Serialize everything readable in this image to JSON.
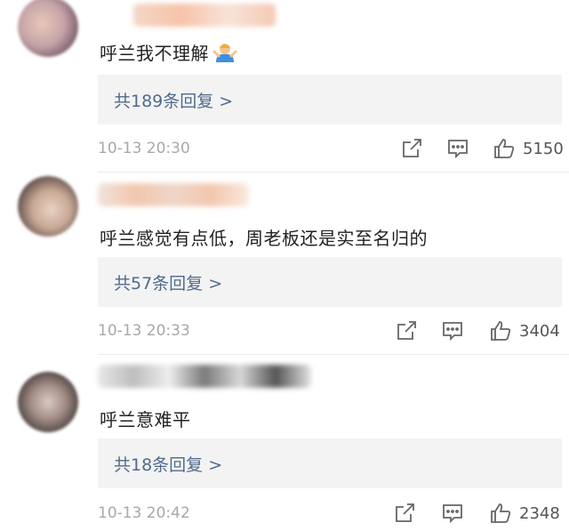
{
  "comments": [
    {
      "text": "呼兰我不理解",
      "emoji": "person-tipping-hand-emoji",
      "replies_label": "共189条回复 >",
      "time": "10-13 20:30",
      "likes": "5150"
    },
    {
      "text": "呼兰感觉有点低，周老板还是实至名归的",
      "replies_label": "共57条回复 >",
      "time": "10-13 20:33",
      "likes": "3404"
    },
    {
      "text": "呼兰意难平",
      "replies_label": "共18条回复 >",
      "time": "10-13 20:42",
      "likes": "2348"
    }
  ],
  "colors": {
    "reply_link": "#506b8c",
    "reply_bg": "#f3f3f3",
    "time": "#a8a8a8",
    "icon": "#666666"
  }
}
